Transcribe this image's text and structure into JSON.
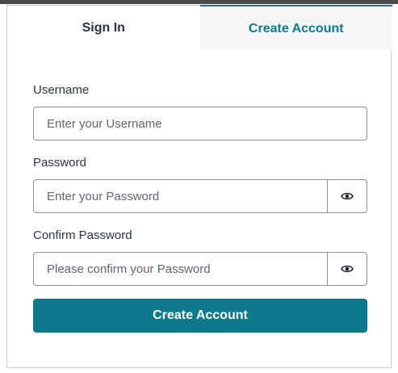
{
  "tabs": [
    {
      "label": "Sign In",
      "active": false
    },
    {
      "label": "Create Account",
      "active": true
    }
  ],
  "form": {
    "username": {
      "label": "Username",
      "placeholder": "Enter your Username",
      "value": ""
    },
    "password": {
      "label": "Password",
      "placeholder": "Enter your Password",
      "value": "",
      "toggle_icon": "eye-icon"
    },
    "confirm_password": {
      "label": "Confirm Password",
      "placeholder": "Please confirm your Password",
      "value": "",
      "toggle_icon": "eye-icon"
    },
    "submit_label": "Create Account"
  },
  "colors": {
    "accent": "#0c7a8c",
    "text": "#2b3442",
    "border": "#8c9097",
    "inactive_tab_bg": "#f4f5f6"
  }
}
